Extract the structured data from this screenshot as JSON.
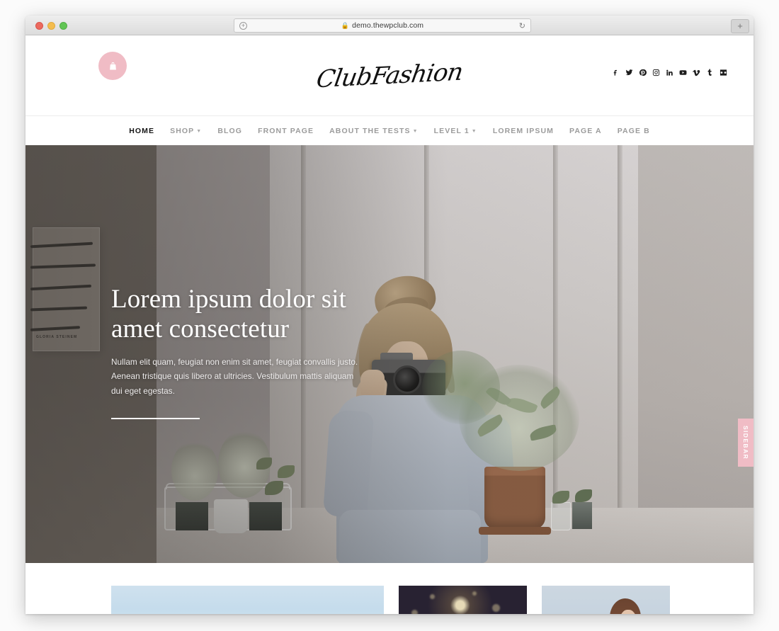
{
  "browser": {
    "url": "demo.thewpclub.com",
    "lock_icon": "lock-icon",
    "reload_icon": "reload-icon",
    "add_icon": "plus-circle-icon",
    "new_tab_label": "+",
    "traffic_lights": [
      "close",
      "minimize",
      "maximize"
    ]
  },
  "site": {
    "logo_text": "ClubFashion",
    "cart_icon": "shopping-bag-icon",
    "accent_color": "#f0bcc5",
    "social": [
      {
        "name": "facebook",
        "label": "f"
      },
      {
        "name": "twitter",
        "label": "t"
      },
      {
        "name": "pinterest",
        "label": "p"
      },
      {
        "name": "instagram",
        "label": "ig"
      },
      {
        "name": "linkedin",
        "label": "in"
      },
      {
        "name": "youtube",
        "label": "yt"
      },
      {
        "name": "vimeo",
        "label": "v"
      },
      {
        "name": "tumblr",
        "label": "t"
      },
      {
        "name": "flickr",
        "label": "fl"
      }
    ]
  },
  "nav": {
    "items": [
      {
        "label": "HOME",
        "active": true,
        "has_dropdown": false
      },
      {
        "label": "SHOP",
        "active": false,
        "has_dropdown": true
      },
      {
        "label": "BLOG",
        "active": false,
        "has_dropdown": false
      },
      {
        "label": "FRONT PAGE",
        "active": false,
        "has_dropdown": false
      },
      {
        "label": "ABOUT THE TESTS",
        "active": false,
        "has_dropdown": true
      },
      {
        "label": "LEVEL 1",
        "active": false,
        "has_dropdown": true
      },
      {
        "label": "LOREM IPSUM",
        "active": false,
        "has_dropdown": false
      },
      {
        "label": "PAGE A",
        "active": false,
        "has_dropdown": false
      },
      {
        "label": "PAGE B",
        "active": false,
        "has_dropdown": false
      }
    ]
  },
  "hero": {
    "title": "Lorem ipsum dolor sit amet consectetur",
    "text": "Nullam elit quam, feugiat non enim sit amet, feugiat convallis justo. Aenean tristique quis libero at ultricies. Vestibulum mattis aliquam dui eget egestas.",
    "poster_credit": "GLORIA STEINEM",
    "image_description": "Woman with blonde hair in a bun holding a vintage film camera, seated on a windowsill surrounded by potted plants"
  },
  "sidebar_tab": {
    "label": "SIDEBAR"
  },
  "cards": [
    {
      "name": "card-sky",
      "description": "Pale blue sky photograph"
    },
    {
      "name": "card-night",
      "description": "Dark night photograph with golden bokeh lights"
    },
    {
      "name": "card-portrait",
      "description": "Portrait of a woman against a pale sky"
    }
  ]
}
